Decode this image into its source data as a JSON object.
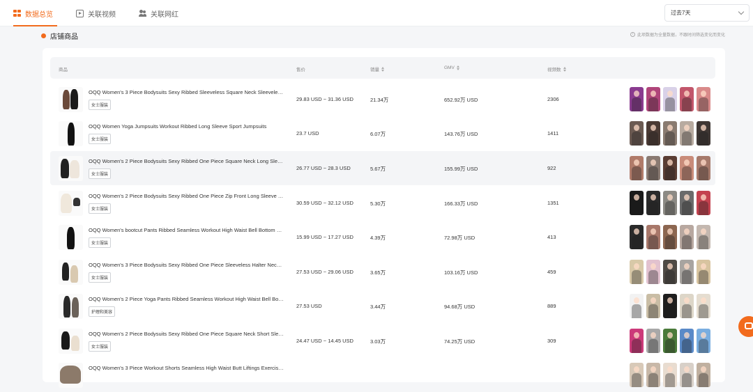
{
  "tabs": [
    {
      "label": "数据总览",
      "icon": "grid-icon",
      "active": true
    },
    {
      "label": "关联视频",
      "icon": "video-icon",
      "active": false
    },
    {
      "label": "关联网红",
      "icon": "users-icon",
      "active": false
    }
  ],
  "period_select": {
    "value": "过去7天"
  },
  "section": {
    "title": "店铺商品",
    "note": "此项数据为全量数据，不跟时间筛选变化而变化"
  },
  "table": {
    "headers": {
      "product": "商品",
      "price": "售价",
      "sales": "销量",
      "gmv": "GMV",
      "videos": "视频数"
    },
    "rows": [
      {
        "name": "OQQ Women's 3 Piece Bodysuits Sexy Ribbed Sleeveless Square Neck Sleeveless Tops",
        "tag": "女士服装",
        "price": "29.83 USD ~ 31.36 USD",
        "sales": "21.34万",
        "gmv": "652.92万 USD",
        "videos": "2306"
      },
      {
        "name": "OQQ Women Yoga Jumpsuits Workout Ribbed Long Sleeve Sport Jumpsuits",
        "tag": "女士服装",
        "price": "23.7 USD",
        "sales": "6.07万",
        "gmv": "143.76万 USD",
        "videos": "1411"
      },
      {
        "name": "OQQ Women's 2 Piece Bodysuits Sexy Ribbed One Piece Square Neck Long Sleeve Tops",
        "tag": "女士服装",
        "price": "26.77 USD ~ 28.3 USD",
        "sales": "5.67万",
        "gmv": "155.99万 USD",
        "videos": "922"
      },
      {
        "name": "OQQ Women's 2 Piece Bodysuits Sexy Ribbed One Piece Zip Front Long Sleeve Tops",
        "tag": "女士服装",
        "price": "30.59 USD ~ 32.12 USD",
        "sales": "5.30万",
        "gmv": "166.33万 USD",
        "videos": "1351"
      },
      {
        "name": "OQQ Women's bootcut Pants Ribbed Seamless Workout High Waist Bell Bottom Pants",
        "tag": "女士服装",
        "price": "15.99 USD ~ 17.27 USD",
        "sales": "4.39万",
        "gmv": "72.98万 USD",
        "videos": "413"
      },
      {
        "name": "OQQ Women's 3 Piece Bodysuits Sexy Ribbed One Piece Sleeveless Halter Neck Tops",
        "tag": "女士服装",
        "price": "27.53 USD ~ 29.06 USD",
        "sales": "3.65万",
        "gmv": "103.16万 USD",
        "videos": "459"
      },
      {
        "name": "OQQ Women's 2 Piece Yoga Pants Ribbed Seamless Workout High Waist Bell Bottom",
        "tag": "护理和美容",
        "price": "27.53 USD",
        "sales": "3.44万",
        "gmv": "94.68万 USD",
        "videos": "889"
      },
      {
        "name": "OQQ Women's 2 Piece Bodysuits Sexy Ribbed One Piece Square Neck Short Sleeve Tops",
        "tag": "女士服装",
        "price": "24.47 USD ~ 14.45 USD",
        "sales": "3.03万",
        "gmv": "74.25万 USD",
        "videos": "309"
      },
      {
        "name": "OQQ Women's 3 Piece Workout Shorts Seamless High Waist Butt Liftings Exercise Shorts",
        "tag": "",
        "price": "",
        "sales": "",
        "gmv": "",
        "videos": ""
      }
    ]
  },
  "colors": {
    "accent": "#f26b1d"
  }
}
